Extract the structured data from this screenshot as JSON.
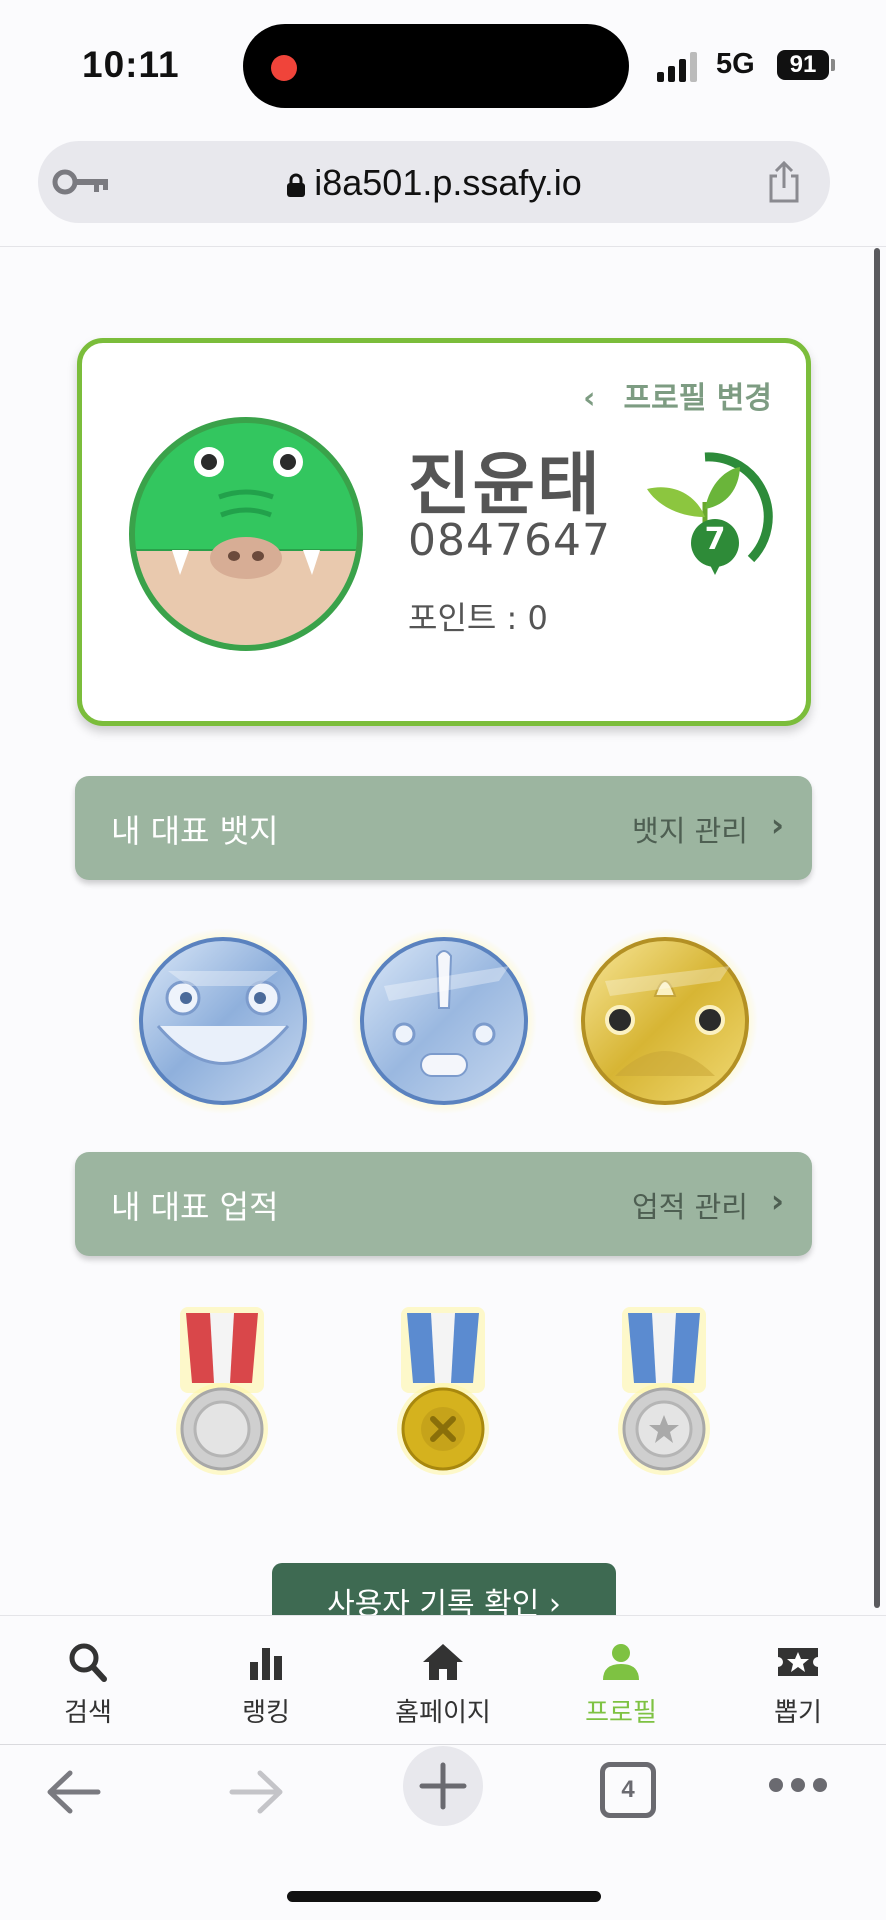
{
  "status_bar": {
    "time": "10:11",
    "network": "5G",
    "battery": "91"
  },
  "browser": {
    "url": "i8a501.p.ssafy.io",
    "open_tabs": "4"
  },
  "profile": {
    "edit_label": "프로필 변경",
    "edit_chevron": "‹",
    "name": "진윤태",
    "user_id": "0847647",
    "points": "포인트 : 0",
    "level": "7",
    "avatar_icon": "crocodile-avatar-icon",
    "accent_color": "#7bbd3b"
  },
  "badges_section": {
    "title": "내 대표 뱃지",
    "link": "뱃지 관리",
    "chevron": "›",
    "badges": [
      "blue-frog-badge-icon",
      "blue-rhino-badge-icon",
      "gold-rhino-badge-icon"
    ]
  },
  "achievements_section": {
    "title": "내 대표 업적",
    "link": "업적 관리",
    "chevron": "›",
    "medals": [
      "red-silver-medal-icon",
      "blue-gold-medal-icon",
      "blue-silver-star-medal-icon"
    ]
  },
  "record_button": {
    "label": "사용자 기록 확인  ›"
  },
  "tab_bar": {
    "tabs": [
      {
        "label": "검색",
        "icon": "search-icon"
      },
      {
        "label": "랭킹",
        "icon": "bar-chart-icon"
      },
      {
        "label": "홈페이지",
        "icon": "home-icon"
      },
      {
        "label": "프로필",
        "icon": "person-icon",
        "active": true
      },
      {
        "label": "뽑기",
        "icon": "ticket-icon"
      }
    ],
    "active_color": "#7ec242"
  },
  "colors": {
    "section_header": "#9cb5a0",
    "record_button": "#3e6a52"
  }
}
